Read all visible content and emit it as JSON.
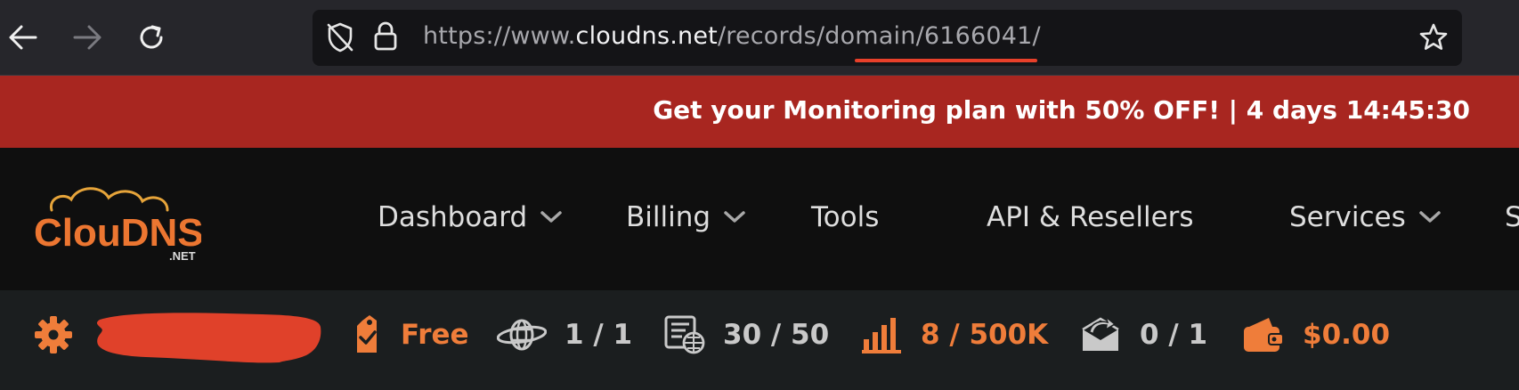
{
  "browser": {
    "url_prefix": "https://www.",
    "url_host": "cloudns.net",
    "url_path": "/records/domain/6166041/",
    "icons": [
      "back-arrow-icon",
      "forward-arrow-icon",
      "reload-icon",
      "tracking-protection-icon",
      "lock-icon",
      "star-icon"
    ]
  },
  "promo": {
    "text": "Get your Monitoring plan with 50% OFF! | 4 days 14:45:30"
  },
  "logo": {
    "text": "ClouDNS",
    "suffix": ".NET"
  },
  "nav": {
    "items": [
      {
        "label": "Dashboard",
        "dropdown": true
      },
      {
        "label": "Billing",
        "dropdown": true
      },
      {
        "label": "Tools",
        "dropdown": false
      },
      {
        "label": "API & Resellers",
        "dropdown": false
      },
      {
        "label": "Services",
        "dropdown": true
      },
      {
        "label": "S",
        "dropdown": false
      }
    ]
  },
  "stats": {
    "plan": "Free",
    "zones": "1 / 1",
    "records": "30 / 50",
    "queries": "8 / 500K",
    "mail": "0 / 1",
    "balance": "$0.00"
  },
  "colors": {
    "accent_orange": "#ef7d3a",
    "promo_red": "#a82620",
    "url_underline": "#e8402a",
    "redaction": "#e0412a"
  }
}
